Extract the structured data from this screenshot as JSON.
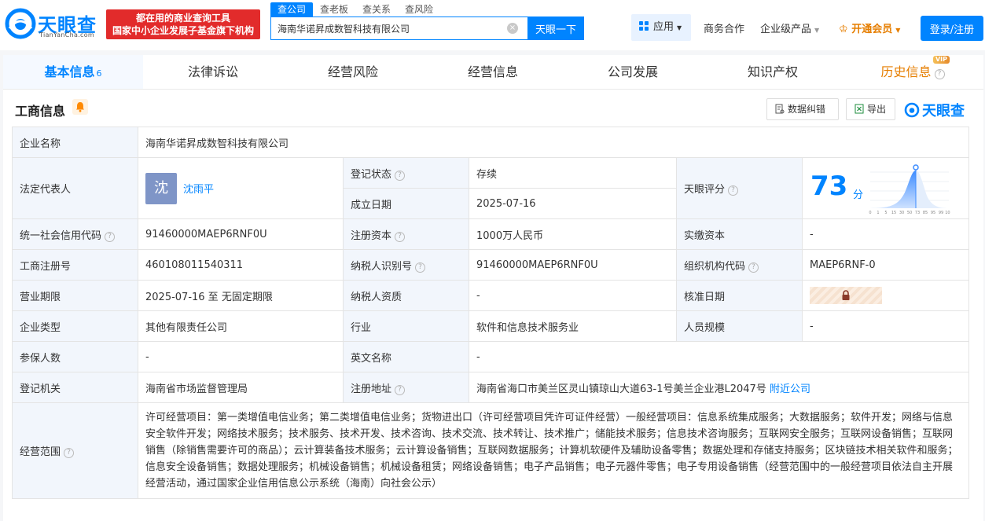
{
  "header": {
    "logo_text": "天眼查",
    "logo_sub": "TianYanCha.com",
    "promo_line1": "都在用的商业查询工具",
    "promo_line2": "国家中小企业发展子基金旗下机构",
    "search_tabs": [
      "查公司",
      "查老板",
      "查关系",
      "查风险"
    ],
    "search_value": "海南华诺昇成数智科技有限公司",
    "search_button": "天眼一下",
    "apps": "应用",
    "nav": [
      "商务合作",
      "企业级产品"
    ],
    "vip": "开通会员",
    "login": "登录/注册"
  },
  "tabs": [
    {
      "label": "基本信息",
      "count": "6"
    },
    {
      "label": "法律诉讼"
    },
    {
      "label": "经营风险"
    },
    {
      "label": "经营信息"
    },
    {
      "label": "公司发展"
    },
    {
      "label": "知识产权"
    },
    {
      "label": "历史信息",
      "badge": "VIP"
    }
  ],
  "section": {
    "title": "工商信息",
    "correct_btn": "数据纠错",
    "export_btn": "导出",
    "brand": "天眼查"
  },
  "info": {
    "company_name_k": "企业名称",
    "company_name_v": "海南华诺昇成数智科技有限公司",
    "legal_rep_k": "法定代表人",
    "legal_rep_avatar": "沈",
    "legal_rep_v": "沈雨平",
    "status_k": "登记状态",
    "status_v": "存续",
    "founded_k": "成立日期",
    "founded_v": "2025-07-16",
    "score_k": "天眼评分",
    "score_v": "73",
    "score_unit": "分",
    "credit_code_k": "统一社会信用代码",
    "credit_code_v": "91460000MAEP6RNF0U",
    "reg_capital_k": "注册资本",
    "reg_capital_v": "1000万人民币",
    "paid_capital_k": "实缴资本",
    "paid_capital_v": "-",
    "reg_no_k": "工商注册号",
    "reg_no_v": "460108011540311",
    "taxpayer_id_k": "纳税人识别号",
    "taxpayer_id_v": "91460000MAEP6RNF0U",
    "org_code_k": "组织机构代码",
    "org_code_v": "MAEP6RNF-0",
    "term_k": "营业期限",
    "term_v": "2025-07-16 至 无固定期限",
    "taxpayer_qual_k": "纳税人资质",
    "taxpayer_qual_v": "-",
    "approve_date_k": "核准日期",
    "type_k": "企业类型",
    "type_v": "其他有限责任公司",
    "industry_k": "行业",
    "industry_v": "软件和信息技术服务业",
    "staff_k": "人员规模",
    "staff_v": "-",
    "insured_k": "参保人数",
    "insured_v": "-",
    "english_k": "英文名称",
    "english_v": "-",
    "authority_k": "登记机关",
    "authority_v": "海南省市场监督管理局",
    "address_k": "注册地址",
    "address_v": "海南省海口市美兰区灵山镇琼山大道63-1号美兰企业港L2047号",
    "nearby": "附近公司",
    "scope_k": "经营范围",
    "scope_v": "许可经营项目：第一类增值电信业务；第二类增值电信业务；货物进出口（许可经营项目凭许可证件经营）一般经营项目：信息系统集成服务；大数据服务；软件开发；网络与信息安全软件开发；网络技术服务；技术服务、技术开发、技术咨询、技术交流、技术转让、技术推广；储能技术服务；信息技术咨询服务；互联网安全服务；互联网设备销售；互联网销售（除销售需要许可的商品）；云计算装备技术服务；云计算设备销售；互联网数据服务；计算机软硬件及辅助设备零售；数据处理和存储支持服务；区块链技术相关软件和服务；信息安全设备销售；数据处理服务；机械设备销售；机械设备租赁；网络设备销售；电子产品销售；电子元器件零售；电子专用设备销售（经营范围中的一般经营项目依法自主开展经营活动，通过国家企业信用信息公示系统（海南）向社会公示）"
  },
  "score_axis": [
    "0",
    "1",
    "5",
    "15",
    "30",
    "50",
    "73",
    "85",
    "95",
    "99",
    "100"
  ],
  "colors": {
    "accent": "#0084ff",
    "vip": "#e67e00",
    "active_green": "#00a64f",
    "promo_red": "#e22b2b"
  }
}
